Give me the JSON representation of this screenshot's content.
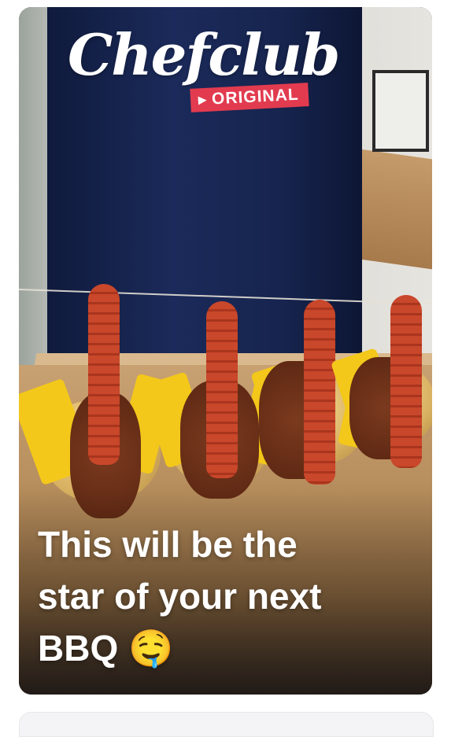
{
  "post": {
    "brand_logo_text": "Chefclub",
    "badge_label": "ORIGINAL",
    "caption_line1": "This will be the",
    "caption_line2": "star of your next",
    "caption_line3": "BBQ 🤤"
  },
  "colors": {
    "badge": "#e23b4f",
    "caption_text": "#ffffff",
    "apron": "#16244e"
  }
}
